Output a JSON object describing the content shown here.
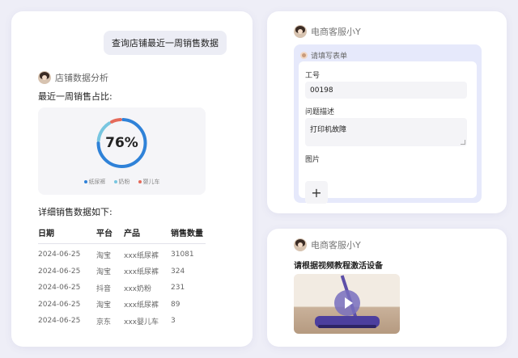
{
  "chat": {
    "user_message": "查询店铺最近一周销售数据",
    "agent_name": "店铺数据分析",
    "share_title": "最近一周销售占比:",
    "detail_title": "详细销售数据如下:"
  },
  "chart_data": {
    "type": "pie",
    "center_label": "76%",
    "categories": [
      "纸尿裤",
      "奶粉",
      "婴儿车"
    ],
    "values": [
      76,
      16,
      8
    ],
    "colors": [
      "#2f82d8",
      "#78c6e0",
      "#e56a5a"
    ],
    "legend_position": "bottom"
  },
  "table": {
    "headers": [
      "日期",
      "平台",
      "产品",
      "销售数量"
    ],
    "rows": [
      [
        "2024-06-25",
        "淘宝",
        "xxx纸尿裤",
        "31081"
      ],
      [
        "2024-06-25",
        "淘宝",
        "xxx纸尿裤",
        "324"
      ],
      [
        "2024-06-25",
        "抖音",
        "xxx奶粉",
        "231"
      ],
      [
        "2024-06-25",
        "淘宝",
        "xxx纸尿裤",
        "89"
      ],
      [
        "2024-06-25",
        "京东",
        "xxx婴儿车",
        "3"
      ]
    ]
  },
  "form_card": {
    "agent_name": "电商客服小Y",
    "form_header": "请填写表单",
    "field_id_label": "工号",
    "field_id_value": "00198",
    "field_desc_label": "问题描述",
    "field_desc_value": "打印机故障",
    "field_image_label": "图片",
    "add_symbol": "+"
  },
  "video_card": {
    "agent_name": "电商客服小Y",
    "title": "请根据视频教程激活设备"
  }
}
